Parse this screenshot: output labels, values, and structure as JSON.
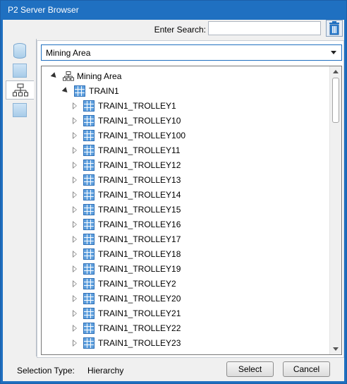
{
  "window": {
    "title": "P2 Server Browser"
  },
  "search": {
    "label": "Enter Search:",
    "value": "",
    "placeholder": ""
  },
  "icons": {
    "trash": "trash-icon",
    "database": "database-icon",
    "hierarchy": "hierarchy-icon",
    "grid": "grid-icon"
  },
  "dropdown": {
    "selected": "Mining Area"
  },
  "tree": {
    "root": "Mining Area",
    "group": "TRAIN1",
    "items": [
      "TRAIN1_TROLLEY1",
      "TRAIN1_TROLLEY10",
      "TRAIN1_TROLLEY100",
      "TRAIN1_TROLLEY11",
      "TRAIN1_TROLLEY12",
      "TRAIN1_TROLLEY13",
      "TRAIN1_TROLLEY14",
      "TRAIN1_TROLLEY15",
      "TRAIN1_TROLLEY16",
      "TRAIN1_TROLLEY17",
      "TRAIN1_TROLLEY18",
      "TRAIN1_TROLLEY19",
      "TRAIN1_TROLLEY2",
      "TRAIN1_TROLLEY20",
      "TRAIN1_TROLLEY21",
      "TRAIN1_TROLLEY22",
      "TRAIN1_TROLLEY23"
    ]
  },
  "footer": {
    "selection_type_label": "Selection Type:",
    "selection_type_value": "Hierarchy"
  },
  "buttons": {
    "select": "Select",
    "cancel": "Cancel"
  },
  "colors": {
    "titlebar": "#1f70c1",
    "accent": "#1f6fc0",
    "grid_icon": "#5fa0de"
  }
}
